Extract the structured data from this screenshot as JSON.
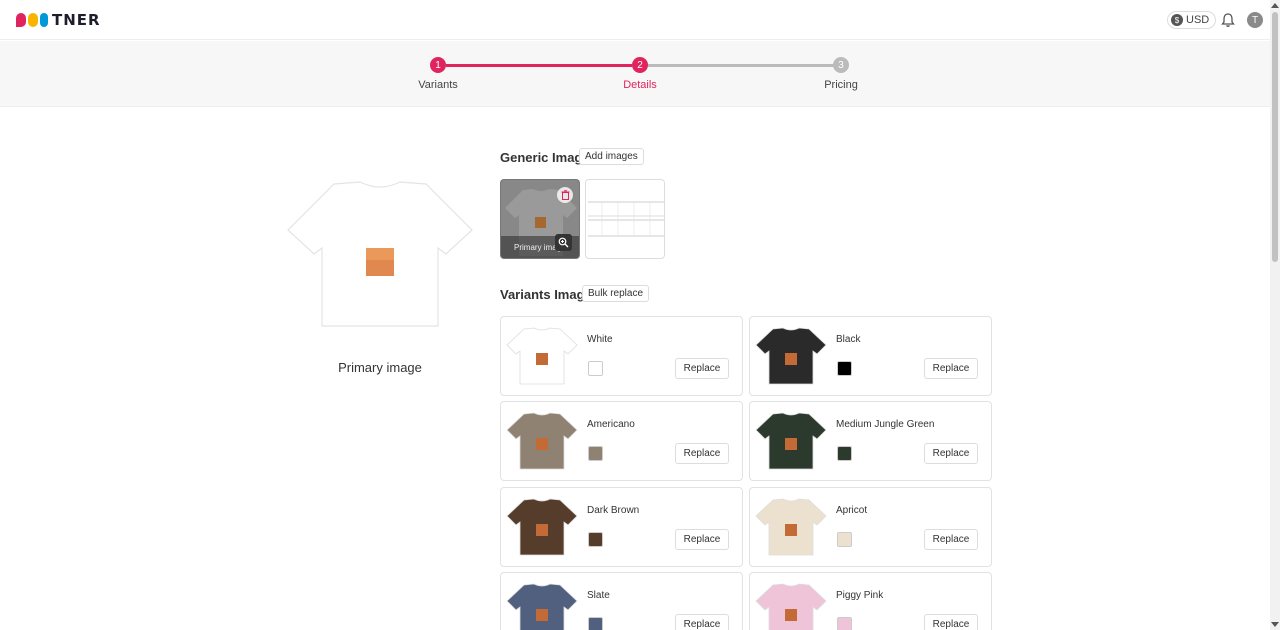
{
  "header": {
    "logo_text": "TNER",
    "currency": "USD",
    "currency_icon": "dollar-coin-icon",
    "avatar_initial": "T"
  },
  "stepper": {
    "active_color": "#e0245e",
    "inactive_color": "#bbbbbb",
    "steps": [
      {
        "number": "1",
        "label": "Variants",
        "state": "done"
      },
      {
        "number": "2",
        "label": "Details",
        "state": "active"
      },
      {
        "number": "3",
        "label": "Pricing",
        "state": "pending"
      }
    ]
  },
  "primary": {
    "label": "Primary image",
    "color": "#ffffff"
  },
  "generic_images": {
    "title": "Generic Images",
    "add_label": "Add images",
    "thumb_caption": "Primary image"
  },
  "variants_images": {
    "title": "Variants Images",
    "bulk_label": "Bulk replace",
    "replace_label": "Replace",
    "items": [
      {
        "name": "White",
        "color": "#ffffff"
      },
      {
        "name": "Black",
        "color": "#000000"
      },
      {
        "name": "Americano",
        "color": "#8f8272"
      },
      {
        "name": "Medium Jungle Green",
        "color": "#2c3a2e"
      },
      {
        "name": "Dark Brown",
        "color": "#563c2a"
      },
      {
        "name": "Apricot",
        "color": "#ece1cf"
      },
      {
        "name": "Slate",
        "color": "#51607f"
      },
      {
        "name": "Piggy Pink",
        "color": "#f0c4d8"
      }
    ]
  }
}
